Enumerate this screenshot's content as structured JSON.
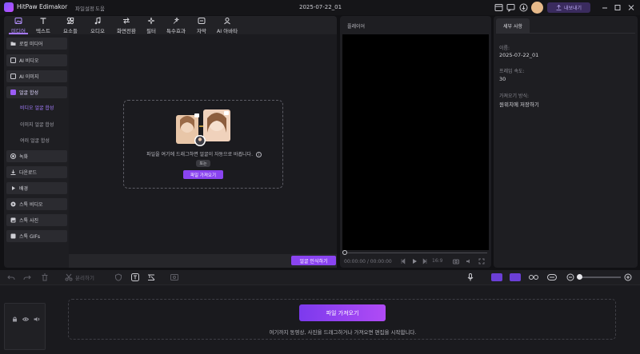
{
  "app": {
    "name": "HitPaw Edimakor",
    "menu": [
      "파일",
      "설정",
      "도움"
    ],
    "project_title": "2025-07-22_01",
    "export_label": "내보내기"
  },
  "toolbar": [
    {
      "label": "미디어",
      "icon": "media-icon"
    },
    {
      "label": "텍스트",
      "icon": "text-icon"
    },
    {
      "label": "요소들",
      "icon": "elements-icon"
    },
    {
      "label": "오디오",
      "icon": "audio-icon"
    },
    {
      "label": "화면전환",
      "icon": "transition-icon"
    },
    {
      "label": "필터",
      "icon": "filter-icon"
    },
    {
      "label": "특수효과",
      "icon": "effects-icon"
    },
    {
      "label": "자막",
      "icon": "subtitle-icon"
    },
    {
      "label": "AI 아바타",
      "icon": "avatar-icon"
    }
  ],
  "sidebar": {
    "local_media": "로컬 미디어",
    "ai_video": "AI 비디오",
    "ai_image": "AI 이미지",
    "face_merge": "얼굴 합성",
    "sub": [
      "비디오 얼굴 합성",
      "이미지 얼굴 합성",
      "여러 얼굴 합성"
    ],
    "record": "녹화",
    "download": "다운로드",
    "background": "배경",
    "stock_video": "스톡 비디오",
    "stock_photo": "스톡 사진",
    "stock_gifs": "스톡 GIFs"
  },
  "dropzone": {
    "text": "파일을 여기에 드래그하면 얼굴이 자동으로 바뀝니다.",
    "or": "또는",
    "import": "파일 가져오기"
  },
  "face_recognize_label": "얼굴 인식하기",
  "player": {
    "title": "플레이어",
    "time": "00:00:00 / 00:00:00",
    "ratio": "16:9"
  },
  "details": {
    "tab": "세부 사항",
    "name_label": "이름:",
    "name_value": "2025-07-22_01",
    "fps_label": "프레임 속도:",
    "fps_value": "30",
    "import_label": "가져오기 방식:",
    "import_value": "원위치에 저장하기"
  },
  "timeline": {
    "split_label": "분리하기",
    "import_label": "파일 가져오기",
    "hint": "여기까지 동영상, 사진을 드래그하거나 가져오면 편집을 시작합니다."
  },
  "colors": {
    "accent": "#8a44f0",
    "accent_light": "#a57dff",
    "bg": "#111114",
    "panel": "#1e1e22"
  }
}
